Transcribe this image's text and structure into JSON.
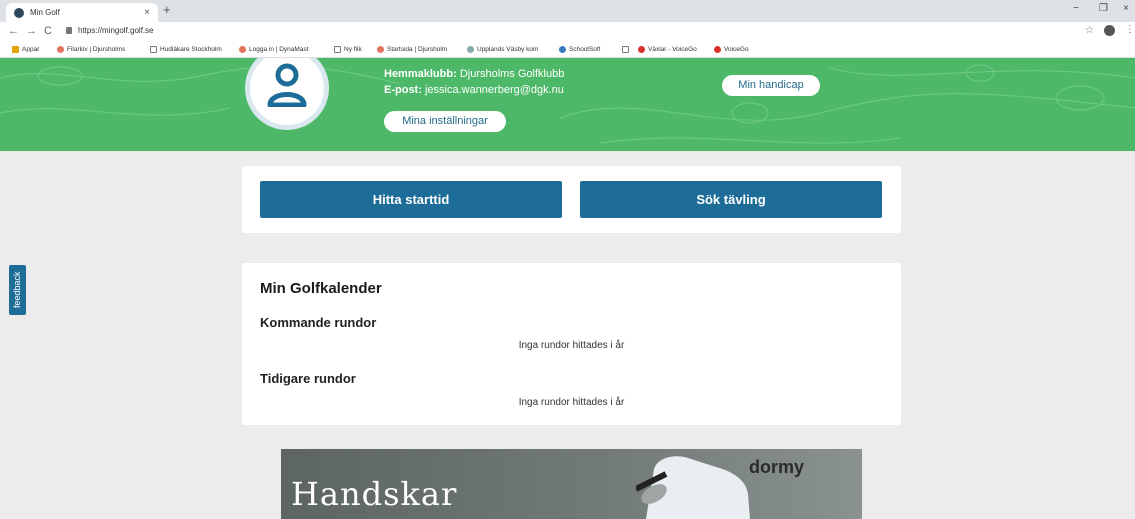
{
  "browser": {
    "tab_title": "Min Golf",
    "tab_close": "×",
    "new_tab": "+",
    "url": "https://mingolf.golf.se",
    "window_controls": [
      "−",
      "❐",
      "×"
    ],
    "nav": [
      "←",
      "→",
      "C"
    ],
    "star": "☆",
    "menu": "⋮",
    "bookmarks": [
      "Appar",
      "Filarkiv | Djursholms",
      "Hudläkare Stockholm",
      "Logga in | DynaMast",
      "Ny flik",
      "Startsida | Djursholm",
      "Upplands Väsby kom",
      "SchoolSoft",
      "Växlar - VoiceGo",
      "VoiceGo"
    ]
  },
  "profile": {
    "club_label": "Hemmaklubb:",
    "club_value": "Djursholms Golfklubb",
    "email_label": "E-post:",
    "email_value": "jessica.wannerberg@dgk.nu",
    "settings_button": "Mina inställningar",
    "handicap_button": "Min handicap"
  },
  "actions": {
    "find_tee_time": "Hitta starttid",
    "search_competition": "Sök tävling"
  },
  "calendar": {
    "title": "Min Golfkalender",
    "upcoming_title": "Kommande rundor",
    "upcoming_empty": "Inga rundor hittades i år",
    "previous_title": "Tidigare rundor",
    "previous_empty": "Inga rundor hittades i år"
  },
  "ad": {
    "headline": "Handskar",
    "brand": "dormy"
  },
  "feedback_label": "feedback",
  "colors": {
    "green": "#4db968",
    "primary": "#1d6d98"
  }
}
